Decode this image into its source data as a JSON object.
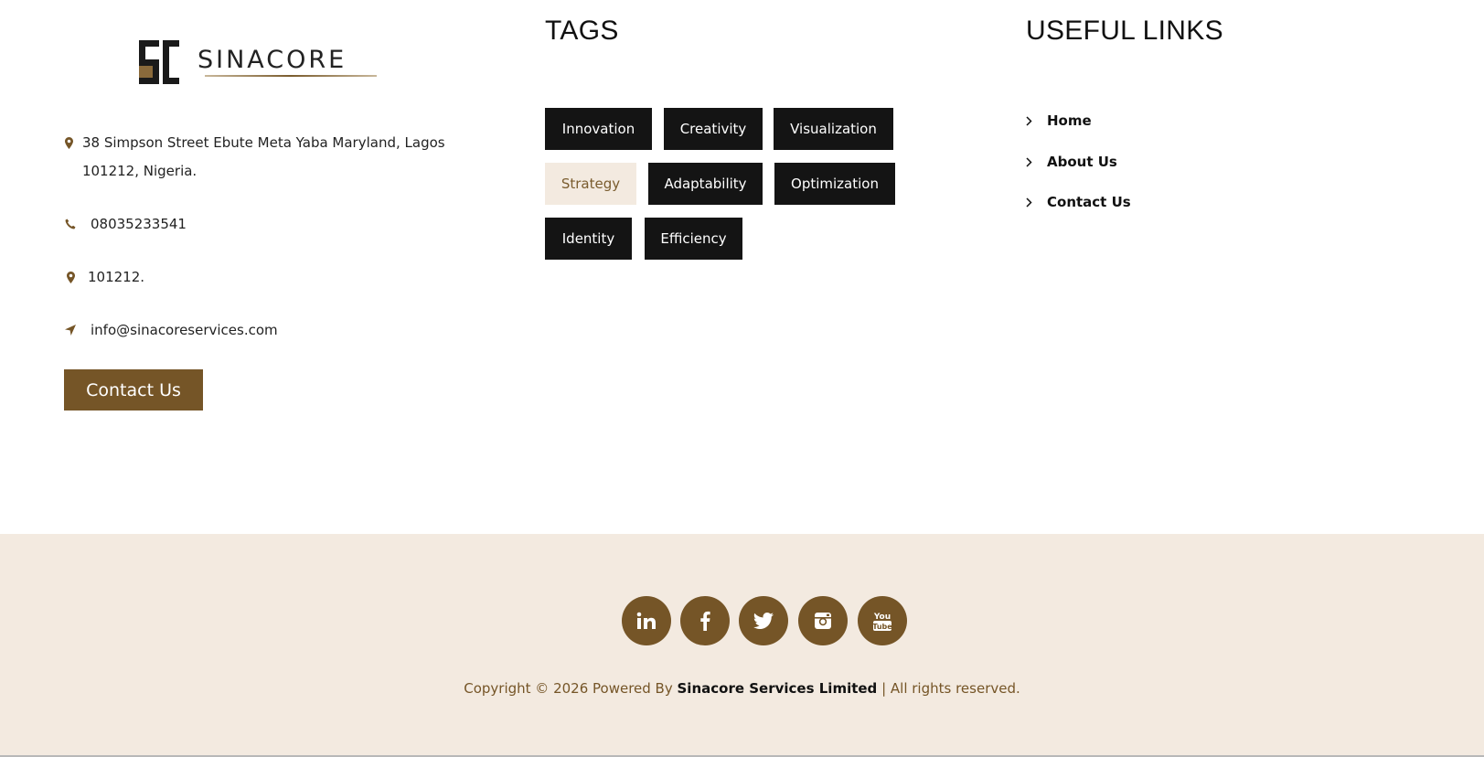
{
  "brand": {
    "logo_text": "SINACORE",
    "accent_color": "#755527",
    "light_color": "#f3eae0"
  },
  "contact": {
    "address_icon": "map-marker-icon",
    "address": "38 Simpson Street Ebute Meta Yaba Maryland, Lagos 101212, Nigeria.",
    "phone_icon": "phone-icon",
    "phone": "08035233541",
    "postal_icon": "map-marker-icon",
    "postal": "101212.",
    "email_icon": "location-arrow-icon",
    "email": "info@sinacoreservices.com",
    "button_label": "Contact Us"
  },
  "tags": {
    "heading": "TAGS",
    "items": [
      {
        "label": "Innovation",
        "active": false
      },
      {
        "label": "Creativity",
        "active": false
      },
      {
        "label": "Visualization",
        "active": false
      },
      {
        "label": "Strategy",
        "active": true
      },
      {
        "label": "Adaptability",
        "active": false
      },
      {
        "label": "Optimization",
        "active": false
      },
      {
        "label": "Identity",
        "active": false
      },
      {
        "label": "Efficiency",
        "active": false
      }
    ]
  },
  "useful_links": {
    "heading": "USEFUL LINKS",
    "items": [
      {
        "label": "Home"
      },
      {
        "label": "About Us"
      },
      {
        "label": "Contact Us"
      }
    ]
  },
  "footer": {
    "social": [
      {
        "name": "linkedin-icon"
      },
      {
        "name": "facebook-icon"
      },
      {
        "name": "twitter-icon"
      },
      {
        "name": "instagram-icon"
      },
      {
        "name": "youtube-icon"
      }
    ],
    "copyright_prefix": "Copyright © 2026 Powered By ",
    "copyright_brand": "Sinacore Services Limited",
    "copyright_suffix": " | All rights reserved."
  }
}
